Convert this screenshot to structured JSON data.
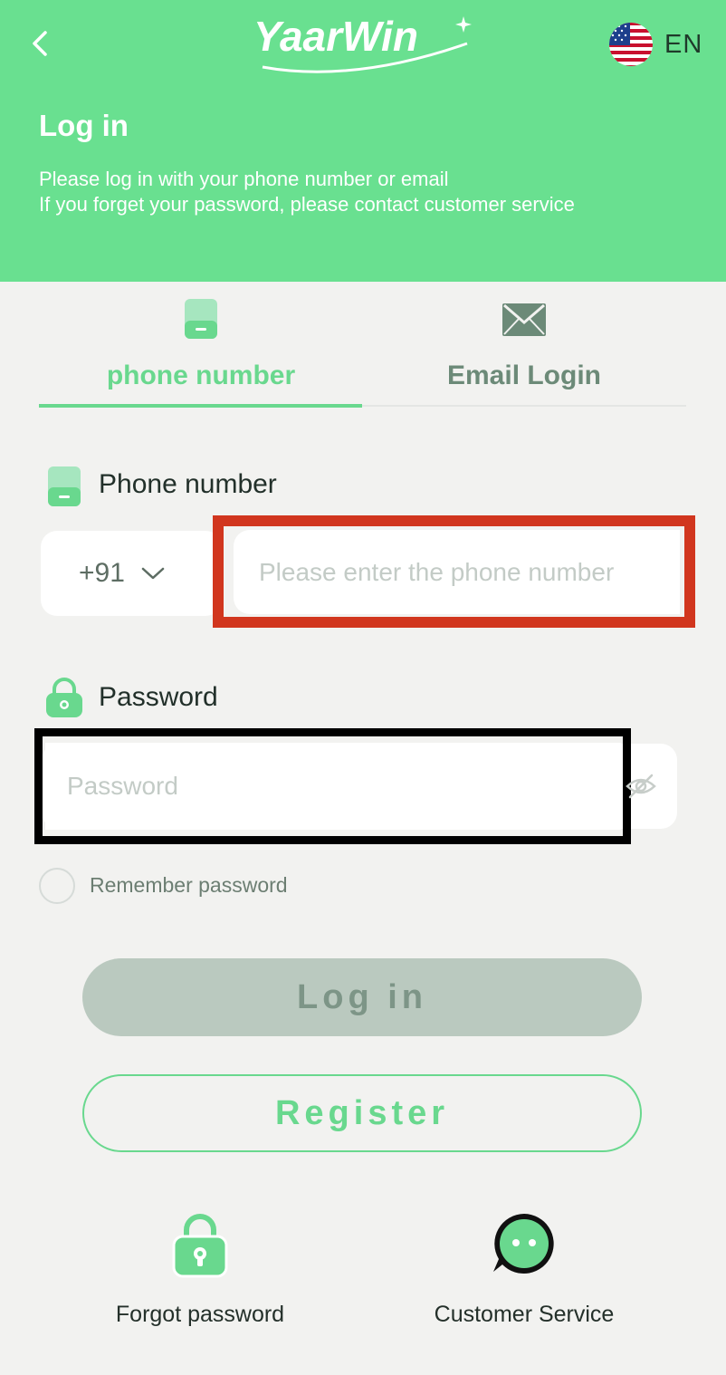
{
  "header": {
    "logo_text": "YaarWin",
    "language": "EN",
    "title": "Log in",
    "subtitle_lines": [
      "Please log in with your phone number or email",
      "If you forget your password, please contact customer service"
    ]
  },
  "tabs": [
    {
      "label": "phone number",
      "icon": "phone-icon",
      "active": true
    },
    {
      "label": "Email Login",
      "icon": "mail-icon",
      "active": false
    }
  ],
  "phone_field": {
    "label": "Phone number",
    "country_code": "+91",
    "value": "",
    "placeholder": "Please enter the phone number"
  },
  "password_field": {
    "label": "Password",
    "value": "",
    "placeholder": "Password"
  },
  "remember": {
    "label": "Remember password",
    "checked": false
  },
  "buttons": {
    "login": "Log in",
    "register": "Register"
  },
  "bottom": {
    "forgot": "Forgot password",
    "service": "Customer Service"
  },
  "colors": {
    "header_bg": "#69e090",
    "accent": "#69d88e",
    "page_bg": "#f2f2f0",
    "login_disabled": "#bac9bf",
    "highlight_red": "#d1361e",
    "highlight_black": "#000000"
  }
}
